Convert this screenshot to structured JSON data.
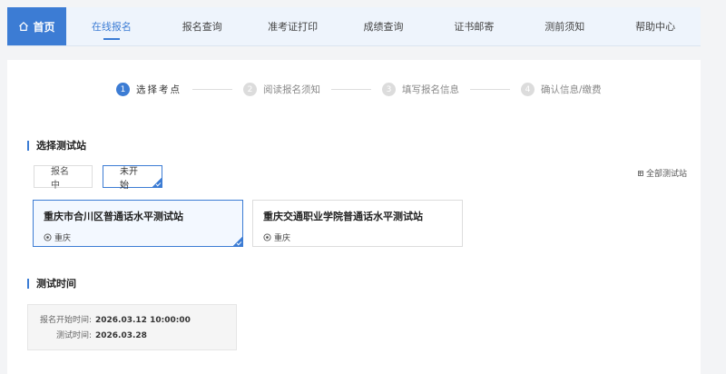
{
  "nav": {
    "home_label": "首页",
    "items": [
      {
        "label": "在线报名",
        "active": true
      },
      {
        "label": "报名查询"
      },
      {
        "label": "准考证打印"
      },
      {
        "label": "成绩查询"
      },
      {
        "label": "证书邮寄"
      },
      {
        "label": "测前须知"
      },
      {
        "label": "帮助中心"
      }
    ]
  },
  "stepper": {
    "steps": [
      {
        "num": "1",
        "label": "选择考点",
        "active": true
      },
      {
        "num": "2",
        "label": "阅读报名须知"
      },
      {
        "num": "3",
        "label": "填写报名信息"
      },
      {
        "num": "4",
        "label": "确认信息/缴费"
      }
    ]
  },
  "station_section": {
    "title": "选择测试站",
    "filters": [
      {
        "label": "报名中"
      },
      {
        "label": "未开始",
        "selected": true
      }
    ],
    "all_stations_label": "全部测试站",
    "stations": [
      {
        "name": "重庆市合川区普通话水平测试站",
        "location": "重庆",
        "selected": true
      },
      {
        "name": "重庆交通职业学院普通话水平测试站",
        "location": "重庆"
      }
    ]
  },
  "time_section": {
    "title": "测试时间",
    "rows": [
      {
        "label": "报名开始时间:",
        "value": "2026.03.12 10:00:00"
      },
      {
        "label": "测试时间:",
        "value": "2026.03.28"
      }
    ]
  },
  "colors": {
    "accent": "#3c7cd4",
    "nav_bg": "#eef4fc",
    "page_bg": "#f3f4f6"
  }
}
